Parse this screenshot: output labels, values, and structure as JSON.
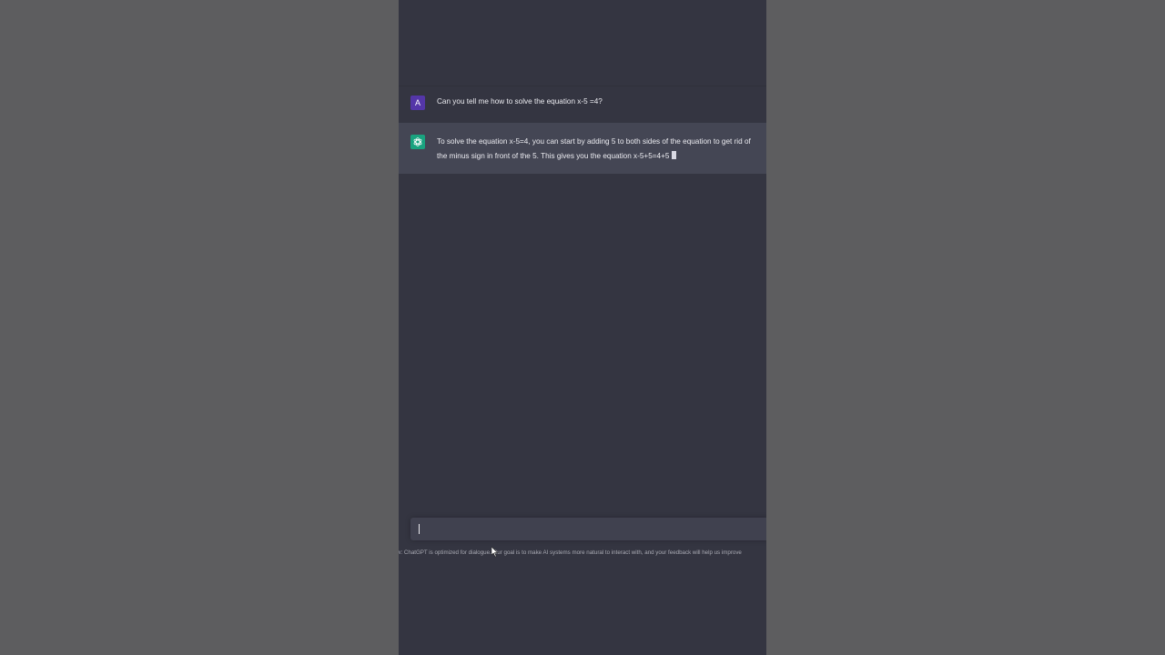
{
  "conversation": {
    "user_message": {
      "avatar_letter": "A",
      "text": "Can you tell me how to solve the equation x-5 =4?"
    },
    "assistant_message": {
      "avatar_icon": "openai-logo-icon",
      "text": "To solve the equation x-5=4, you can start by adding 5 to both sides of the equation to get rid of the minus sign in front of the 5. This gives you the equation x-5+5=4+5"
    }
  },
  "composer": {
    "value": ""
  },
  "footer": {
    "text": "w: ChatGPT is optimized for dialogue. Our goal is to make AI systems more natural to interact with, and your feedback will help us improve"
  },
  "colors": {
    "page_background": "#5d5d5f",
    "chat_background": "#343541",
    "assistant_row_background": "#444654",
    "user_avatar": "#5436a8",
    "assistant_avatar": "#19a37f",
    "input_background": "#40414f"
  }
}
